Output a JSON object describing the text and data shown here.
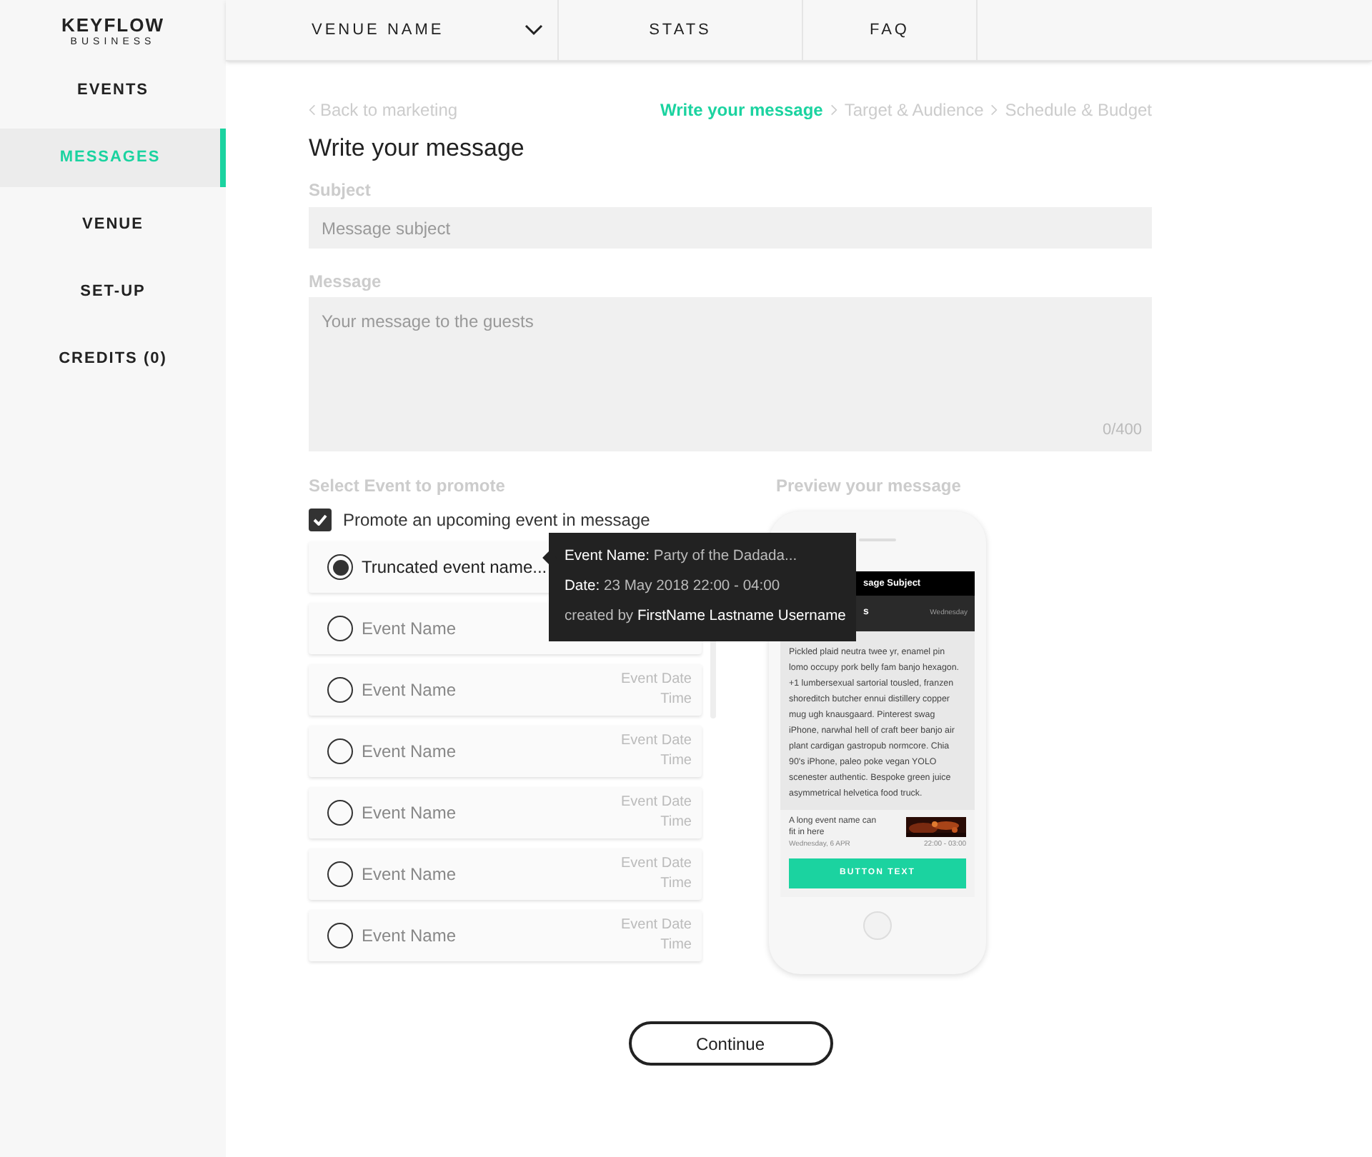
{
  "logo": {
    "title": "KEYFLOW",
    "subtitle": "BUSINESS"
  },
  "sidebar": {
    "items": [
      {
        "label": "EVENTS",
        "selected": false
      },
      {
        "label": "MESSAGES",
        "selected": true
      },
      {
        "label": "VENUE",
        "selected": false
      },
      {
        "label": "SET-UP",
        "selected": false
      },
      {
        "label": "CREDITS (0)",
        "selected": false
      }
    ]
  },
  "top_nav": [
    {
      "label": "VENUE NAME",
      "kind": "dropdown"
    },
    {
      "label": "STATS",
      "kind": "link"
    },
    {
      "label": "FAQ",
      "kind": "link"
    }
  ],
  "breadcrumb": {
    "back": "Back to marketing",
    "steps": [
      {
        "label": "Write your message",
        "selected": true
      },
      {
        "label": "Target & Audience",
        "selected": false
      },
      {
        "label": "Schedule & Budget",
        "selected": false
      }
    ]
  },
  "heading": "Write your message",
  "subject": {
    "label": "Subject",
    "placeholder": "Message subject"
  },
  "message": {
    "label": "Message",
    "placeholder": "Your message to the guests",
    "counter": "0/400"
  },
  "events": {
    "label": "Select Event to promote",
    "promote": {
      "label": "Promote an upcoming event in message",
      "checked": true
    },
    "items": [
      {
        "name": "Truncated event name...",
        "selected": true
      },
      {
        "name": "Event Name",
        "selected": false
      },
      {
        "name": "Event Name",
        "selected": false,
        "date": "Event Date",
        "time": "Time"
      },
      {
        "name": "Event Name",
        "selected": false,
        "date": "Event Date",
        "time": "Time"
      },
      {
        "name": "Event Name",
        "selected": false,
        "date": "Event Date",
        "time": "Time"
      },
      {
        "name": "Event Name",
        "selected": false,
        "date": "Event Date",
        "time": "Time"
      },
      {
        "name": "Event Name",
        "selected": false,
        "date": "Event Date",
        "time": "Time"
      }
    ]
  },
  "tooltip": {
    "name_label": "Event Name:",
    "name": "Party of the Dadada...",
    "date_label": "Date:",
    "date": "23 May 2018  22:00 - 04:00",
    "creator_label": "created by",
    "creator": "FirstName Lastname Username"
  },
  "preview": {
    "label": "Preview your message",
    "subject": "sage Subject",
    "sub_left": "s",
    "sub_right": "Wednesday",
    "body": "Pickled plaid neutra twee yr, enamel pin lomo occupy pork belly fam banjo hexagon. +1 lumbersexual sartorial tousled, franzen shoreditch butcher ennui distillery copper mug ugh knausgaard. Pinterest swag iPhone, narwhal hell of craft beer banjo air plant cardigan gastropub normcore. Chia 90's iPhone, paleo poke vegan YOLO scenester authentic. Bespoke green juice asymmetrical helvetica food truck.",
    "event_name": "A long event name can fit in here",
    "event_date": "Wednesday, 6 APR",
    "event_time": "22:00 - 03:00",
    "button": "BUTTON TEXT"
  },
  "continue_button": "Continue"
}
